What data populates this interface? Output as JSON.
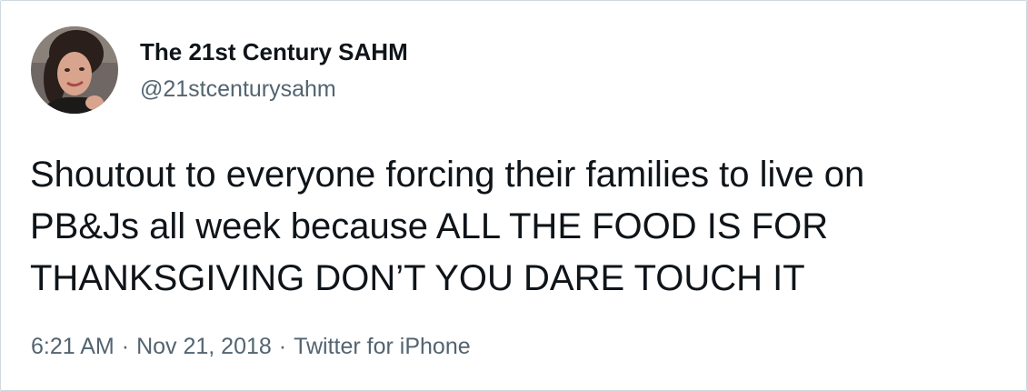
{
  "author": {
    "display_name": "The 21st Century SAHM",
    "handle": "@21stcenturysahm",
    "avatar_icon": "profile-photo"
  },
  "tweet": {
    "lines": [
      "Shoutout to everyone forcing their families to live on",
      "PB&Js all week because ALL THE FOOD IS FOR",
      "THANKSGIVING DON’T YOU DARE TOUCH IT"
    ]
  },
  "meta": {
    "time": "6:21 AM",
    "date": "Nov 21, 2018",
    "source": "Twitter for iPhone",
    "separator": "·"
  },
  "colors": {
    "text_primary": "#0f1419",
    "text_secondary": "#536471",
    "border": "#cfd9de"
  }
}
